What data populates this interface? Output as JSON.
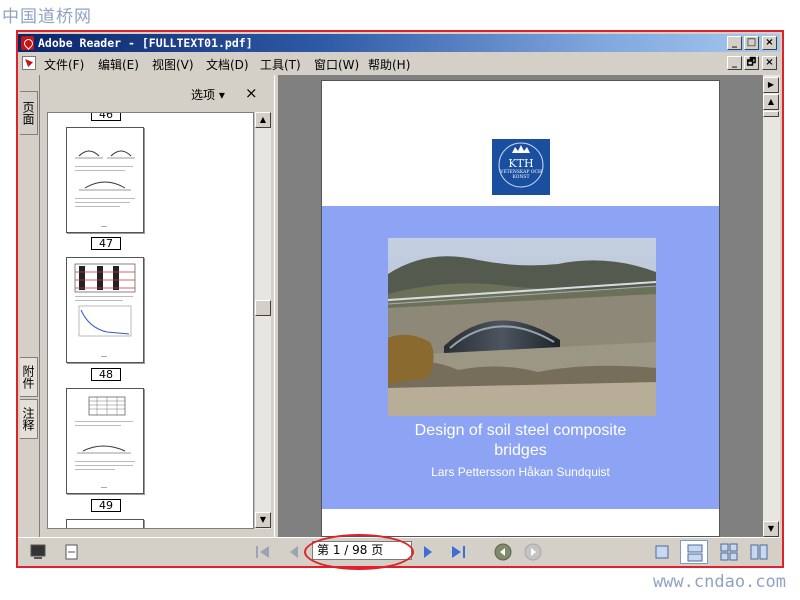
{
  "watermark_top": "中国道桥网",
  "watermark_bottom": "www.cndao.com",
  "window": {
    "title": "Adobe Reader - [FULLTEXT01.pdf]",
    "controls": {
      "minimize": "_",
      "maximize": "□",
      "close": "×"
    }
  },
  "menu": {
    "items": [
      "文件(F)",
      "编辑(E)",
      "视图(V)",
      "文档(D)",
      "工具(T)",
      "窗口(W)",
      "帮助(H)"
    ],
    "doc_controls": {
      "minimize": "_",
      "restore": "🗗",
      "close": "×"
    }
  },
  "left_tabs": [
    "页面",
    "附件",
    "注释"
  ],
  "nav_pane": {
    "options_label": "选项 ▾",
    "close_label": "×",
    "page_numbers": [
      "46",
      "47",
      "48",
      "49"
    ]
  },
  "document": {
    "logo_text": "KTH",
    "logo_subtext": "VETENSKAP OCH KONST",
    "title_line1": "Design of soil steel composite",
    "title_line2": "bridges",
    "authors": "Lars Pettersson Håkan Sundquist"
  },
  "statusbar": {
    "page_display": "第 1 / 98 页",
    "current_page": 1,
    "total_pages": 98
  },
  "colors": {
    "highlight_frame": "#e0202a",
    "cover_band": "#8da4f4",
    "kth_blue": "#1a4fa0"
  }
}
